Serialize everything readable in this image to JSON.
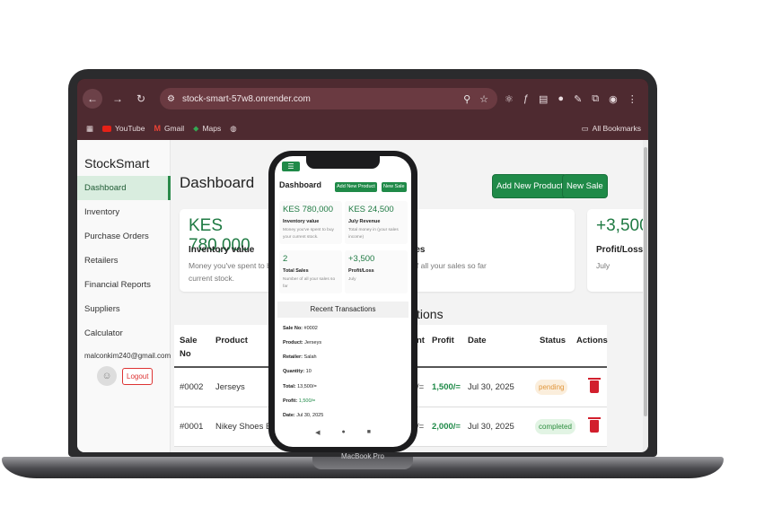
{
  "browser": {
    "url": "stock-smart-57w8.onrender.com",
    "bookmarks": [
      "YouTube",
      "Gmail",
      "Maps"
    ],
    "all_bookmarks": "All Bookmarks"
  },
  "laptop_label": "MacBook Pro",
  "sidebar": {
    "brand": "StockSmart",
    "items": [
      "Dashboard",
      "Inventory",
      "Purchase Orders",
      "Retailers",
      "Financial Reports",
      "Suppliers",
      "Calculator"
    ],
    "email": "malconkim240@gmail.com",
    "logout": "Logout"
  },
  "main": {
    "title": "Dashboard",
    "add_product": "Add New Product",
    "new_sale": "New Sale",
    "cards": [
      {
        "value": "KES 780,000",
        "label": "Inventory value",
        "desc1": "Money you've spent to buy",
        "desc2": "current stock."
      },
      {
        "label_fragment": "ales",
        "desc_fragment": "r of all your sales so far"
      },
      {
        "value": "+3,500",
        "label": "Profit/Loss",
        "desc": "July"
      }
    ],
    "section_fragment": "tions",
    "table": {
      "headers": {
        "sale_no_1": "Sale",
        "sale_no_2": "No",
        "product": "Product",
        "amount_fragment": "nt",
        "profit": "Profit",
        "date": "Date",
        "status": "Status",
        "actions": "Actions"
      },
      "rows": [
        {
          "sale_no": "#0002",
          "product": "Jerseys",
          "amount_fragment": "/=",
          "profit": "1,500/=",
          "date": "Jul 30, 2025",
          "status": "pending"
        },
        {
          "sale_no": "#0001",
          "product": "Nikey Shoes Ba",
          "amount_fragment": "/=",
          "profit": "2,000/=",
          "date": "Jul 30, 2025",
          "status": "completed"
        }
      ]
    }
  },
  "phone": {
    "title": "Dashboard",
    "add_product": "Add New Product",
    "new_sale": "New Sale",
    "cards": [
      {
        "value": "KES 780,000",
        "label": "Inventory value",
        "desc": "Money you've spent to buy your current stock."
      },
      {
        "value": "KES 24,500",
        "label": "July Revenue",
        "desc": "Total money in (your sales income)"
      },
      {
        "value": "2",
        "label": "Total Sales",
        "desc": "Number of all your sales so far"
      },
      {
        "value": "+3,500",
        "label": "Profit/Loss",
        "desc": "July"
      }
    ],
    "recent_title": "Recent Transactions",
    "details": {
      "sale_no_label": "Sale No:",
      "sale_no": "#0002",
      "product_label": "Product:",
      "product": "Jerseys",
      "retailer_label": "Retailer:",
      "retailer": "Salah",
      "quantity_label": "Quantity:",
      "quantity": "10",
      "total_label": "Total:",
      "total": "13,500/=",
      "profit_label": "Profit:",
      "profit": "1,500/=",
      "date_label": "Date:",
      "date": "Jul 30, 2025"
    }
  },
  "colors": {
    "accent": "#1f8a48",
    "browser_bar": "#4e2a30",
    "danger": "#d21f2d"
  }
}
